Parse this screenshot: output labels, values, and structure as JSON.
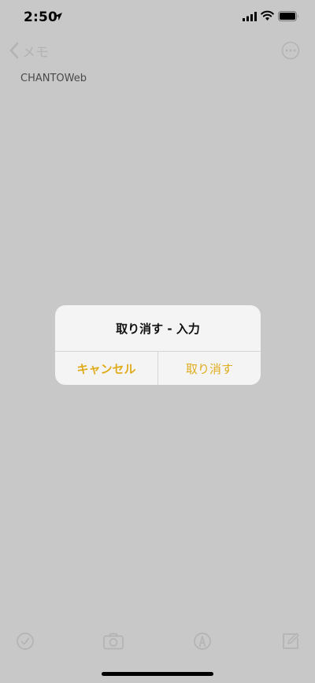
{
  "status_bar": {
    "time": "2:50",
    "icons": [
      "location-arrow-icon",
      "cellular-signal-icon",
      "wifi-icon",
      "battery-icon"
    ]
  },
  "nav": {
    "back_label": "メモ",
    "more_icon": "ellipsis-circle-icon"
  },
  "note": {
    "text": "CHANTOWeb"
  },
  "alert": {
    "title": "取り消す - 入力",
    "cancel_label": "キャンセル",
    "undo_label": "取り消す"
  },
  "toolbar": {
    "icons": [
      "checklist-icon",
      "camera-icon",
      "markup-pen-icon",
      "compose-icon"
    ]
  },
  "colors": {
    "accent": "#e0ac1e",
    "dimmed_background": "#c8c8c8",
    "alert_background": "#f4f4f4"
  }
}
